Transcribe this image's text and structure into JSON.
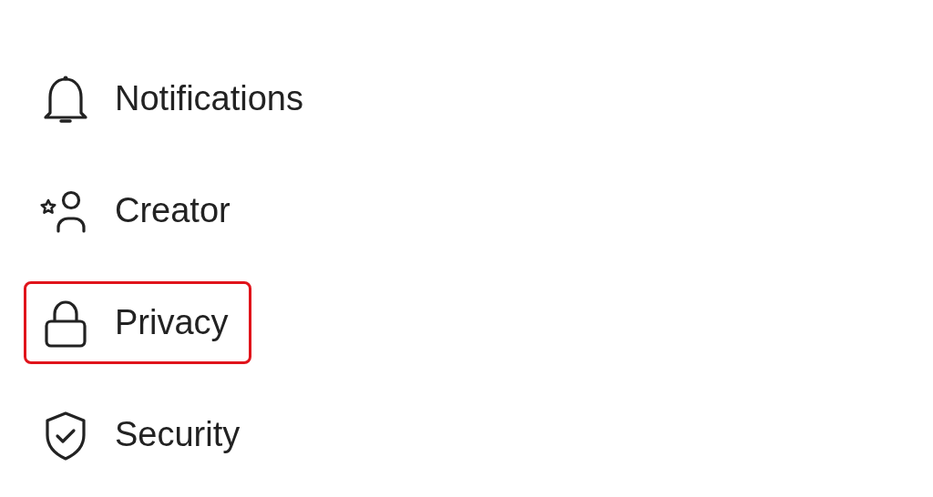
{
  "menu": {
    "items": [
      {
        "label": "Notifications",
        "highlighted": false
      },
      {
        "label": "Creator",
        "highlighted": false
      },
      {
        "label": "Privacy",
        "highlighted": true
      },
      {
        "label": "Security",
        "highlighted": false
      }
    ]
  }
}
